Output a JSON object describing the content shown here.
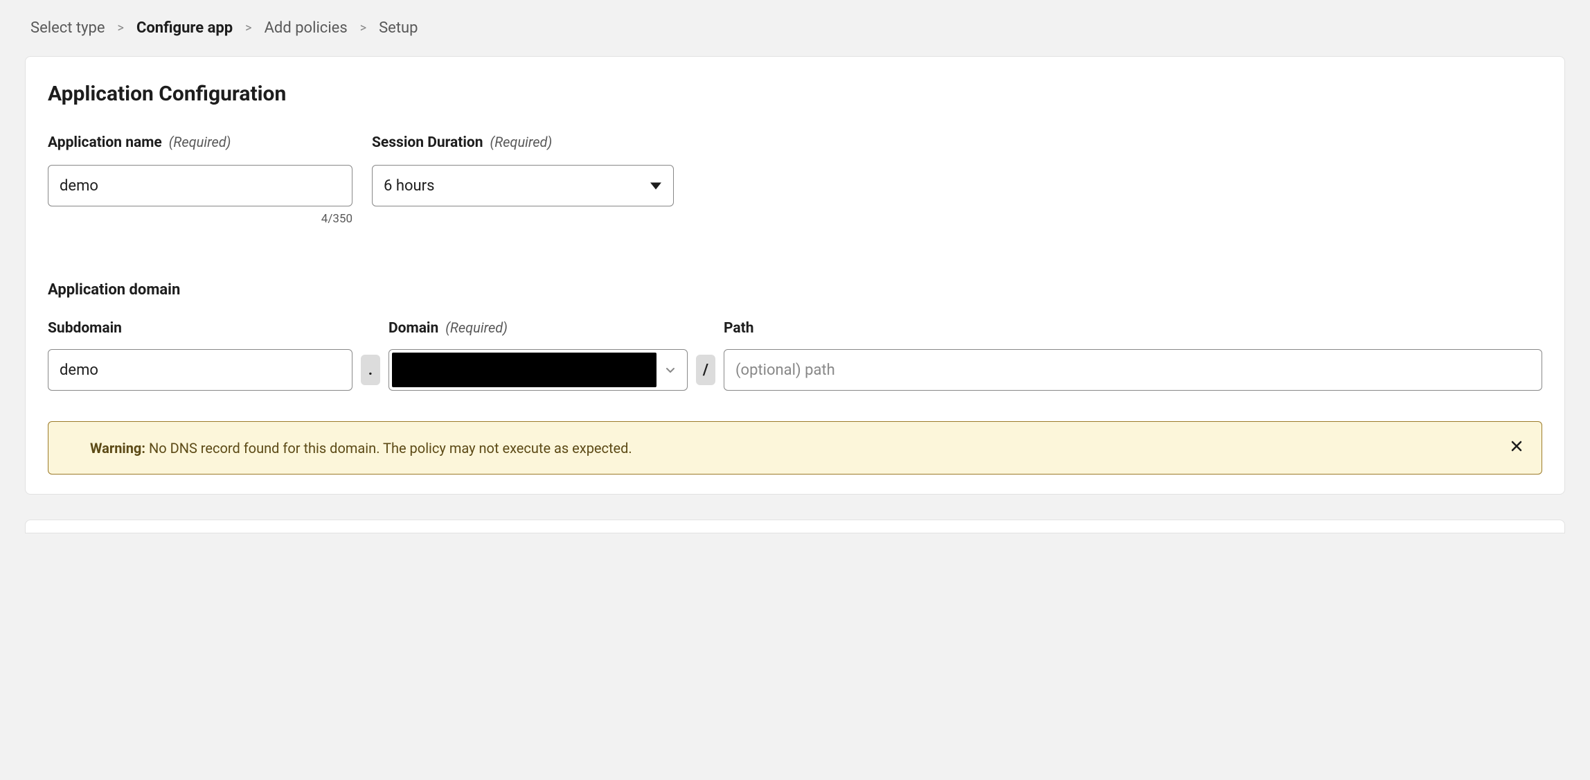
{
  "breadcrumb": {
    "items": [
      {
        "label": "Select type",
        "active": false
      },
      {
        "label": "Configure app",
        "active": true
      },
      {
        "label": "Add policies",
        "active": false
      },
      {
        "label": "Setup",
        "active": false
      }
    ]
  },
  "card": {
    "title": "Application Configuration"
  },
  "app_name": {
    "label": "Application name",
    "required_tag": "(Required)",
    "value": "demo",
    "counter": "4/350"
  },
  "session": {
    "label": "Session Duration",
    "required_tag": "(Required)",
    "value": "6 hours"
  },
  "domain_section": {
    "title": "Application domain",
    "subdomain": {
      "label": "Subdomain",
      "value": "demo"
    },
    "separator_dot": ".",
    "domain": {
      "label": "Domain",
      "required_tag": "(Required)"
    },
    "separator_slash": "/",
    "path": {
      "label": "Path",
      "placeholder": "(optional) path",
      "value": ""
    }
  },
  "alert": {
    "prefix": "Warning:",
    "text": " No DNS record found for this domain. The policy may not execute as expected."
  }
}
